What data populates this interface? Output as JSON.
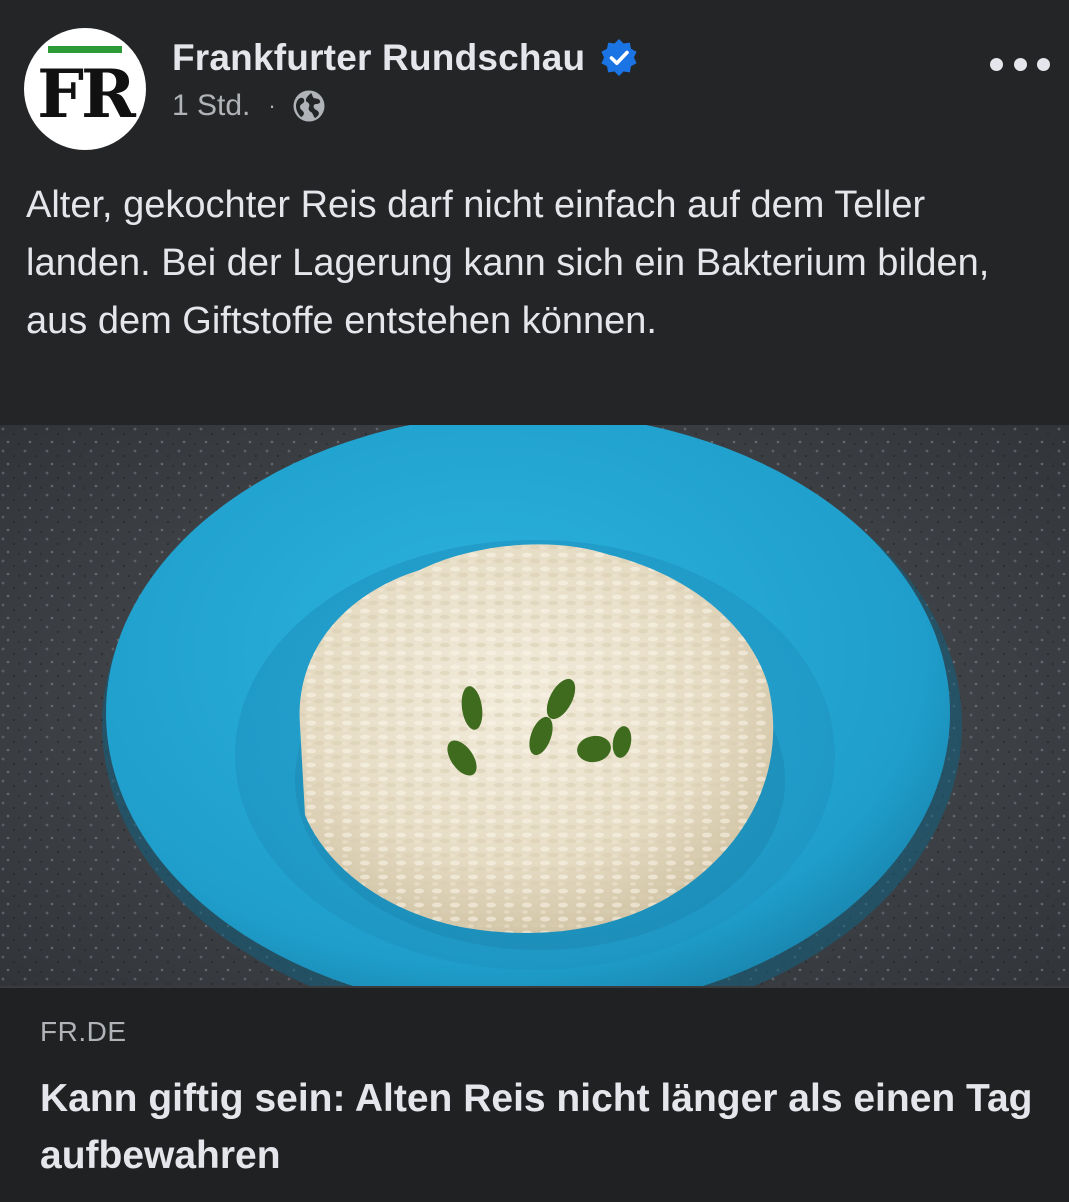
{
  "page": {
    "name": "Frankfurter Rundschau",
    "avatar_text": "FR",
    "time": "1 Std.",
    "separator": "·"
  },
  "post": {
    "text": "Alter, gekochter Reis darf nicht einfach auf dem Teller landen. Bei der Lagerung kann sich ein Bakterium bilden, aus dem Giftstoffe entstehen können."
  },
  "link": {
    "domain": "FR.DE",
    "title": "Kann giftig sein: Alten Reis nicht länger als einen Tag aufbewahren"
  },
  "icons": {
    "verified": "verified-badge-icon",
    "audience": "globe-icon",
    "more": "more-options-icon"
  },
  "colors": {
    "background": "#242526",
    "verified_blue": "#1b74e4",
    "logo_green": "#2c9b35",
    "plate_blue": "#24a6d2"
  }
}
